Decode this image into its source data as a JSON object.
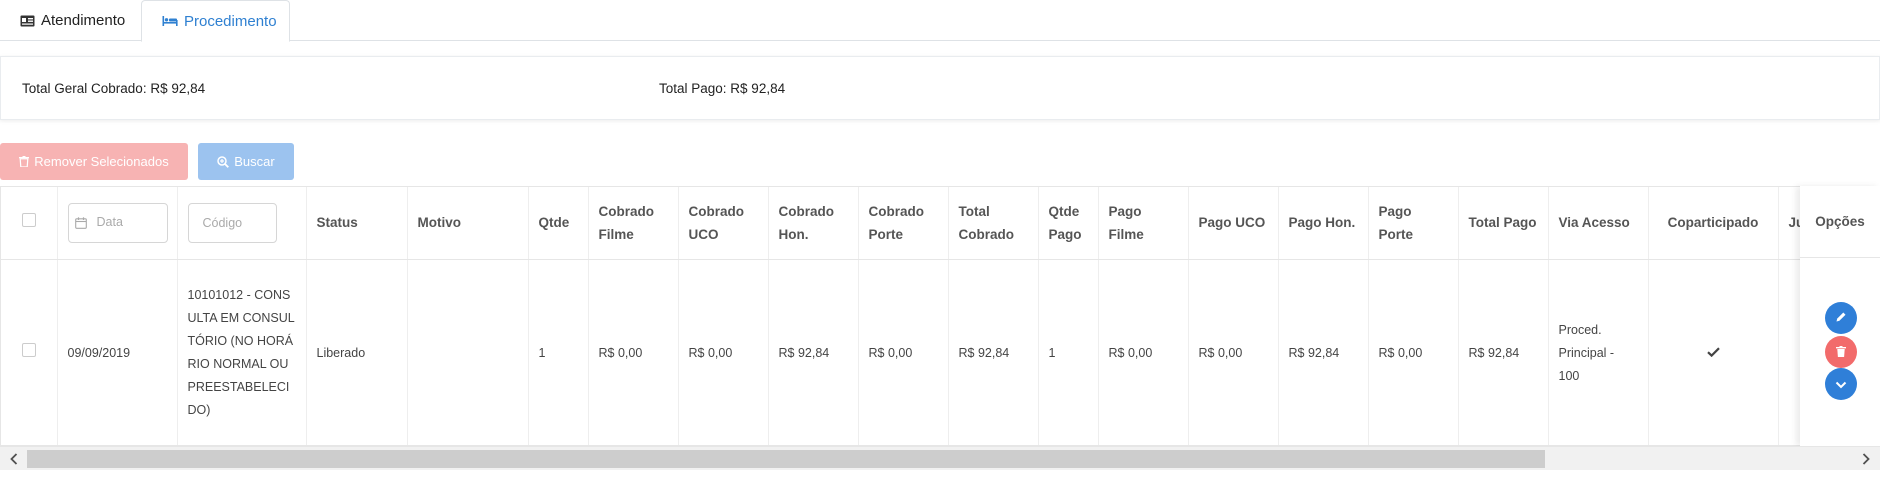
{
  "tabs": [
    {
      "label": "Atendimento",
      "icon": "id-card-icon",
      "active": false
    },
    {
      "label": "Procedimento",
      "icon": "bed-icon",
      "active": true
    }
  ],
  "totals": {
    "geral_cobrado": "Total Geral Cobrado: R$ 92,84",
    "pago": "Total Pago: R$ 92,84"
  },
  "toolbar": {
    "remove_label": "Remover Selecionados",
    "buscar_label": "Buscar"
  },
  "filters": {
    "date_placeholder": "Data",
    "code_placeholder": "Código"
  },
  "columns": {
    "status": "Status",
    "motivo": "Motivo",
    "qtde": "Qtde",
    "cobrado_filme": "Cobrado Filme",
    "cobrado_uco": "Cobrado UCO",
    "cobrado_hon": "Cobrado Hon.",
    "cobrado_porte": "Cobrado Porte",
    "total_cobrado": "Total Cobrado",
    "qtde_pago": "Qtde Pago",
    "pago_filme": "Pago Filme",
    "pago_uco": "Pago UCO",
    "pago_hon": "Pago Hon.",
    "pago_porte": "Pago Porte",
    "total_pago": "Total Pago",
    "via_acesso": "Via Acesso",
    "coparticipado": "Coparticipado",
    "ju": "Ju",
    "opcoes": "Opções"
  },
  "rows": [
    {
      "data": "09/09/2019",
      "codigo": "10101012 - CONSULTA EM CONSULTÓRIO (NO HORÁRIO NORMAL OU PREESTABELECIDO)",
      "status": "Liberado",
      "motivo": "",
      "qtde": "1",
      "cobrado_filme": "R$ 0,00",
      "cobrado_uco": "R$ 0,00",
      "cobrado_hon": "R$ 92,84",
      "cobrado_porte": "R$ 0,00",
      "total_cobrado": "R$ 92,84",
      "qtde_pago": "1",
      "pago_filme": "R$ 0,00",
      "pago_uco": "R$ 0,00",
      "pago_hon": "R$ 92,84",
      "pago_porte": "R$ 0,00",
      "total_pago": "R$ 92,84",
      "via_acesso": "Proced. Principal - 100",
      "coparticipado": true
    }
  ],
  "colors": {
    "primary": "#2f7fd8",
    "danger": "#f26b6b",
    "danger_disabled": "#f7b3b3",
    "primary_disabled": "#9cc3ef"
  }
}
